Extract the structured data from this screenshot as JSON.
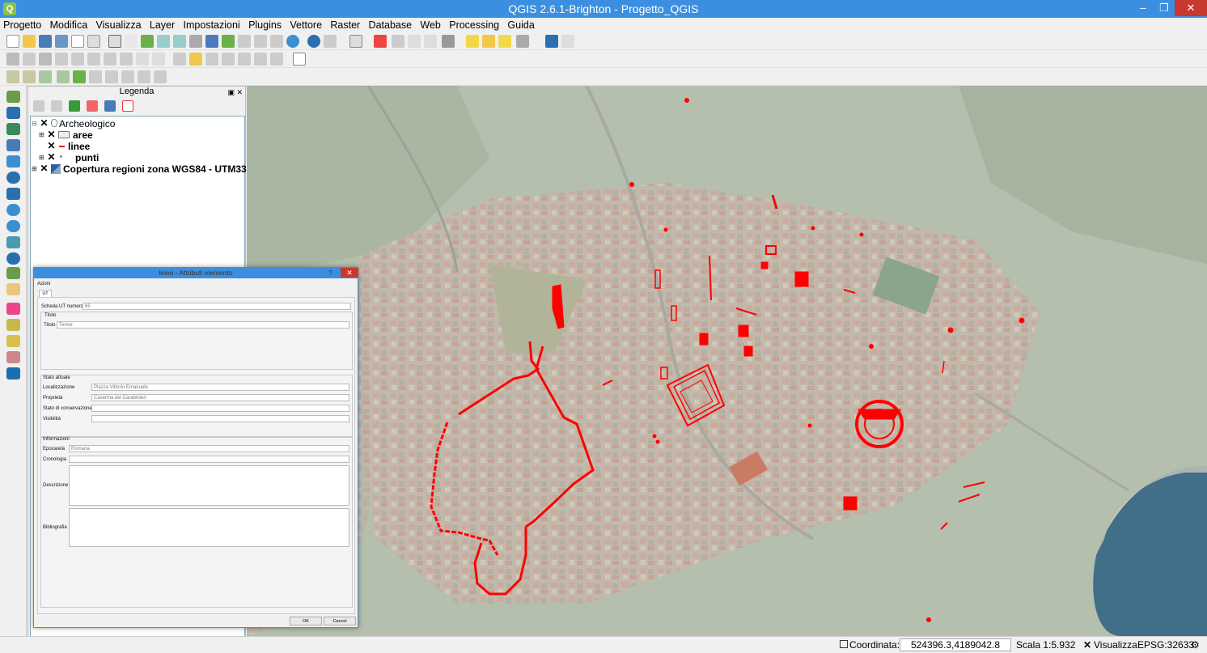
{
  "window": {
    "title": "QGIS 2.6.1-Brighton - Progetto_QGIS",
    "minimize": "–",
    "maximize": "❐",
    "close": "✕",
    "app_icon": "Q"
  },
  "menu": [
    "Progetto",
    "Modifica",
    "Visualizza",
    "Layer",
    "Impostazioni",
    "Plugins",
    "Vettore",
    "Raster",
    "Database",
    "Web",
    "Processing",
    "Guida"
  ],
  "legend": {
    "title": "Legenda",
    "layers": [
      {
        "name": "Archeologico",
        "checked": "✕",
        "expand": "⊟"
      },
      {
        "name": "aree",
        "checked": "✕",
        "expand": "⊞"
      },
      {
        "name": "linee",
        "checked": "✕",
        "expand": ""
      },
      {
        "name": "punti",
        "checked": "✕",
        "expand": "⊞"
      },
      {
        "name": "Copertura regioni zona WGS84 - UTM33",
        "checked": "✕",
        "expand": "⊞"
      }
    ]
  },
  "dialog": {
    "title": "linee - Attributi elemento",
    "help": "?",
    "actions_label": "Azioni",
    "tab": "UT",
    "ut_label": "Scheda UT numero",
    "ut_value": "65",
    "title_group": "Titolo",
    "title_label": "Titolo",
    "title_value": "Terme",
    "stato_group": "Stato attuale",
    "localizzazione_label": "Localizzazione",
    "localizzazione_value": "Piazza Vittorio Emanuele",
    "proprieta_label": "Proprietà",
    "proprieta_value": "Caserma dei Carabinieri",
    "conservazione_label": "Stato di conservazione",
    "conservazione_value": "",
    "visibilita_label": "Visibilità",
    "visibilita_value": "",
    "info_group": "Informazioni",
    "epoca_label": "Epoca/età",
    "epoca_value": "Romana",
    "cronologia_label": "Cronologia",
    "cronologia_value": "",
    "descrizione_label": "Descrizione",
    "bibliografia_label": "Bibliografia",
    "ok": "OK",
    "cancel": "Cancel"
  },
  "status": {
    "coord_label": "Coordinata:",
    "coord_value": "524396.3,4189042.8",
    "scale": "Scala 1:5.932",
    "render_label": "Visualizza",
    "crs": "EPSG:32633"
  },
  "colors": {
    "titlebar": "#3c8fe0",
    "features": "#ff0000",
    "close": "#c7392f"
  }
}
